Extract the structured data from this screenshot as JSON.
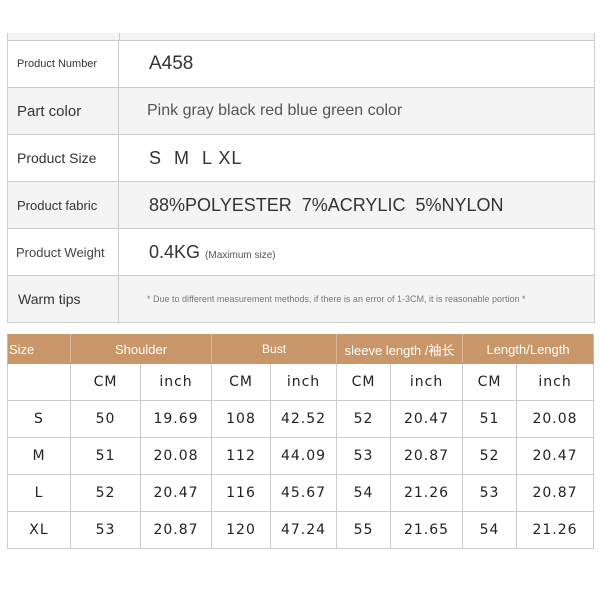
{
  "specs": [
    {
      "label": "Product Number",
      "value": "A458"
    },
    {
      "label": "Part color",
      "value": "Pink gray black red blue green color"
    },
    {
      "label": "Product Size",
      "value": "S  M  L XL"
    },
    {
      "label": "Product fabric",
      "value": "88%POLYESTER  7%ACRYLIC  5%NYLON"
    },
    {
      "label": "Product Weight",
      "value": "0.4KG",
      "note": "(Maximum size)"
    },
    {
      "label": "Warm tips",
      "value": "* Due to different measurement methods, if there is an error of 1-3CM, it is reasonable portion *"
    }
  ],
  "size_table": {
    "header_color": "#c9966a",
    "headers": [
      "Size",
      "Shoulder",
      "Bust",
      "sleeve length /袖长",
      "Length/Length"
    ],
    "units": [
      "",
      "CM",
      "inch",
      "CM",
      "inch",
      "CM",
      "inch",
      "CM",
      "inch"
    ],
    "rows": [
      [
        "S",
        "50",
        "19.69",
        "108",
        "42.52",
        "52",
        "20.47",
        "51",
        "20.08"
      ],
      [
        "M",
        "51",
        "20.08",
        "112",
        "44.09",
        "53",
        "20.87",
        "52",
        "20.47"
      ],
      [
        "L",
        "52",
        "20.47",
        "116",
        "45.67",
        "54",
        "21.26",
        "53",
        "20.87"
      ],
      [
        "XL",
        "53",
        "20.87",
        "120",
        "47.24",
        "55",
        "21.65",
        "54",
        "21.26"
      ]
    ]
  }
}
